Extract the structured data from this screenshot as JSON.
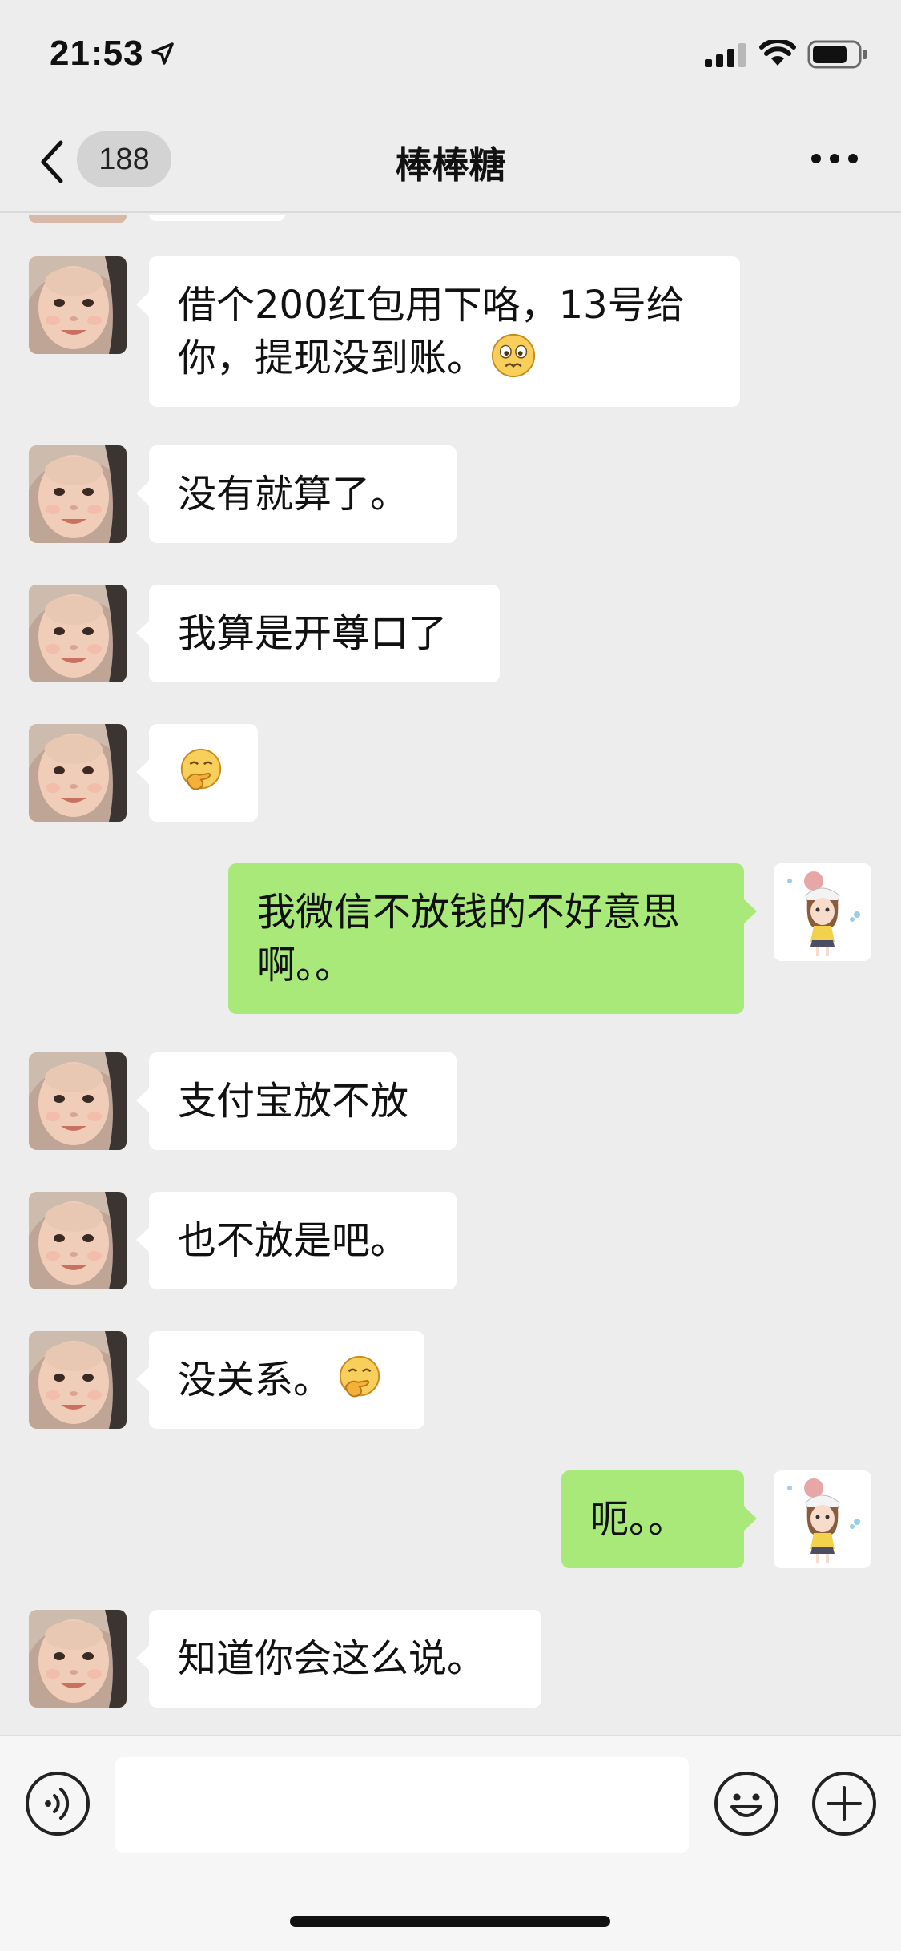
{
  "status_bar": {
    "time": "21:53",
    "icons": [
      "location-arrow-icon",
      "signal-icon",
      "wifi-icon",
      "battery-icon"
    ]
  },
  "nav": {
    "back_icon": "chevron-left-icon",
    "unread_count": "188",
    "title": "棒棒糖",
    "more_icon": "more-dots-icon"
  },
  "colors": {
    "background": "#ededed",
    "incoming_bubble": "#ffffff",
    "outgoing_bubble": "#a9e97a"
  },
  "messages": [
    {
      "side": "in",
      "lines": [
        "借个200红包用下咯，13号给",
        "你，提现没到账。"
      ],
      "emoji": "woozy-face"
    },
    {
      "side": "in",
      "lines": [
        "没有就算了。"
      ]
    },
    {
      "side": "in",
      "lines": [
        "我算是开尊口了"
      ]
    },
    {
      "side": "in",
      "lines": [
        ""
      ],
      "emoji": "hand-over-mouth-face"
    },
    {
      "side": "out",
      "lines": [
        "我微信不放钱的不好意思",
        "啊。。"
      ]
    },
    {
      "side": "in",
      "lines": [
        "支付宝放不放"
      ]
    },
    {
      "side": "in",
      "lines": [
        "也不放是吧。"
      ]
    },
    {
      "side": "in",
      "lines": [
        "没关系。"
      ],
      "emoji": "hand-over-mouth-face"
    },
    {
      "side": "out",
      "lines": [
        "呃。。"
      ]
    },
    {
      "side": "in",
      "lines": [
        "知道你会这么说。"
      ]
    }
  ],
  "input_bar": {
    "voice_icon": "voice-icon",
    "emoji_icon": "smiley-icon",
    "plus_icon": "plus-circle-icon",
    "input_value": ""
  }
}
